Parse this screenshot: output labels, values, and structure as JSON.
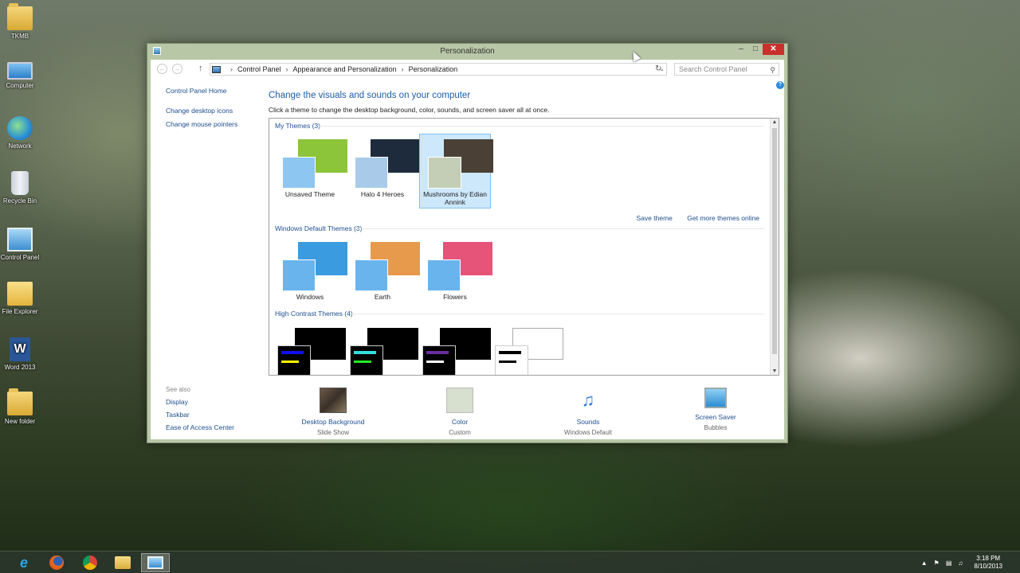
{
  "desktop": {
    "icons": [
      {
        "label": "TKMB",
        "icon": "folder-icon"
      },
      {
        "label": "Computer",
        "icon": "computer-icon"
      },
      {
        "label": "Network",
        "icon": "network-icon"
      },
      {
        "label": "Recycle Bin",
        "icon": "recycle-bin-icon"
      },
      {
        "label": "Control Panel",
        "icon": "control-panel-icon"
      },
      {
        "label": "File Explorer",
        "icon": "file-explorer-icon"
      },
      {
        "label": "Word 2013",
        "icon": "word-icon"
      },
      {
        "label": "New folder",
        "icon": "folder-icon"
      }
    ]
  },
  "window": {
    "title": "Personalization",
    "min_glyph": "–",
    "max_glyph": "□",
    "close_glyph": "✕"
  },
  "nav": {
    "breadcrumb": [
      "Control Panel",
      "Appearance and Personalization",
      "Personalization"
    ],
    "search_placeholder": "Search Control Panel"
  },
  "left_pane": {
    "links": [
      "Control Panel Home",
      "Change desktop icons",
      "Change mouse pointers"
    ],
    "see_also_header": "See also",
    "see_also": [
      "Display",
      "Taskbar",
      "Ease of Access Center"
    ]
  },
  "main": {
    "title": "Change the visuals and sounds on your computer",
    "subtitle": "Click a theme to change the desktop background, color, sounds, and screen saver all at once."
  },
  "sections": {
    "my_themes": "My Themes (3)",
    "default_themes": "Windows Default Themes (3)",
    "high_contrast": "High Contrast Themes (4)"
  },
  "my_themes": [
    {
      "label": "Unsaved Theme",
      "selected": false,
      "bg": "#8cc43a",
      "fg": "#8ec6f2"
    },
    {
      "label": "Halo 4 Heroes",
      "selected": false,
      "bg": "#1d2b3c",
      "fg": "#a9cbe9"
    },
    {
      "label": "Mushrooms by Edian Annink",
      "selected": true,
      "bg": "#4a4036",
      "fg": "#c4cdb6"
    }
  ],
  "default_themes": [
    {
      "label": "Windows",
      "bg": "#3b9be0",
      "fg": "#6ab4ee"
    },
    {
      "label": "Earth",
      "bg": "#e79a4b",
      "fg": "#6ab4ee"
    },
    {
      "label": "Flowers",
      "bg": "#e7547a",
      "fg": "#6ab4ee"
    }
  ],
  "theme_links": {
    "save": "Save theme",
    "more": "Get more themes online"
  },
  "high_contrast_colors": [
    {
      "big": "#000000",
      "small": "#000000",
      "bar1": "#1010f0",
      "bar2": "#ffff00"
    },
    {
      "big": "#000000",
      "small": "#000000",
      "bar1": "#33dddd",
      "bar2": "#22ee22"
    },
    {
      "big": "#000000",
      "small": "#000000",
      "bar1": "#6a2ca0",
      "bar2": "#ffffff"
    },
    {
      "big": "#ffffff",
      "small": "#ffffff",
      "bar1": "#000000",
      "bar2": "#000000"
    }
  ],
  "bottom_items": [
    {
      "label": "Desktop Background",
      "sub": "Slide Show",
      "icon": "desktop-background-icon"
    },
    {
      "label": "Color",
      "sub": "Custom",
      "icon": "color-icon"
    },
    {
      "label": "Sounds",
      "sub": "Windows Default",
      "icon": "sounds-icon"
    },
    {
      "label": "Screen Saver",
      "sub": "Bubbles",
      "icon": "screen-saver-icon"
    }
  ],
  "taskbar": {
    "apps": [
      "internet-explorer-icon",
      "firefox-icon",
      "chrome-icon",
      "file-explorer-icon",
      "control-panel-icon"
    ],
    "time": "3:18 PM",
    "date": "8/10/2013"
  }
}
